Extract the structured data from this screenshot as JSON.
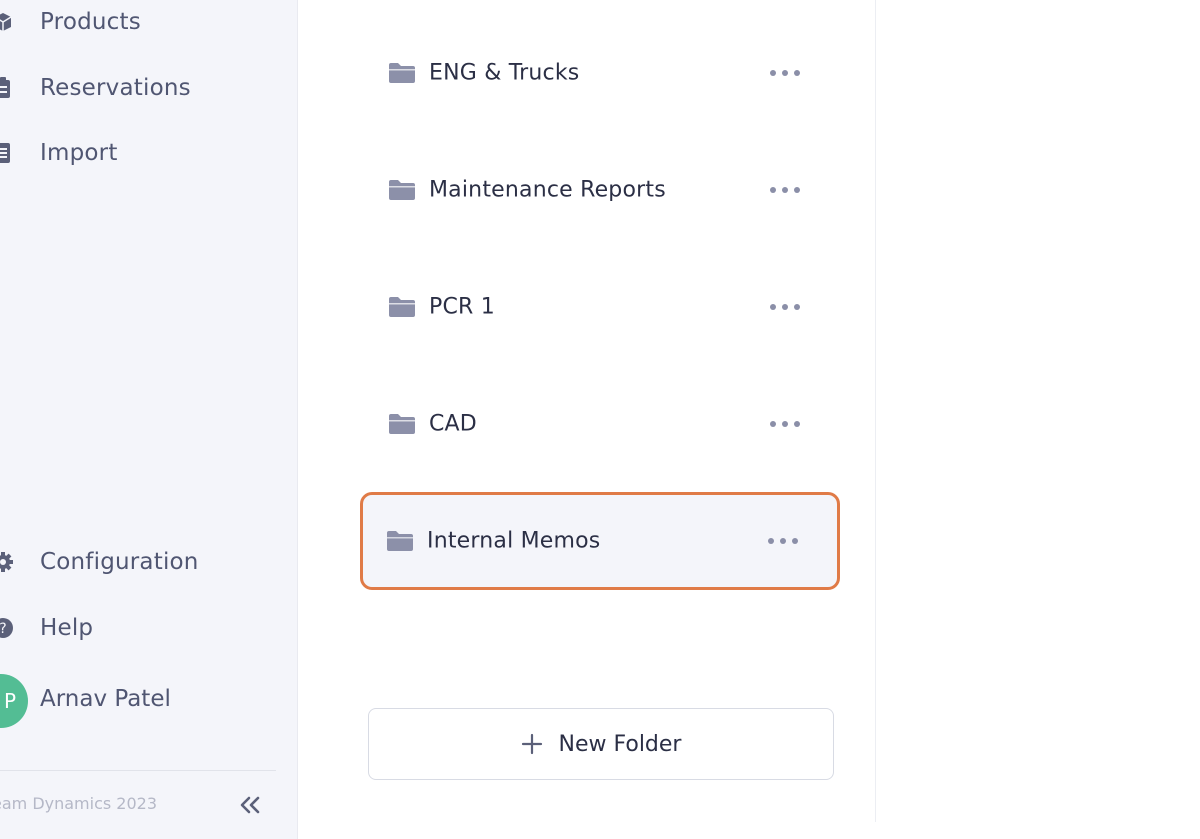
{
  "sidebar": {
    "nav_top": [
      {
        "label": "Products",
        "icon": "products-icon"
      },
      {
        "label": "Reservations",
        "icon": "reservations-icon"
      },
      {
        "label": "Import",
        "icon": "import-icon"
      }
    ],
    "nav_bottom": [
      {
        "label": "Configuration",
        "icon": "gear-icon"
      },
      {
        "label": "Help",
        "icon": "help-icon"
      }
    ],
    "user": {
      "initial": "P",
      "name": "Arnav Patel",
      "avatar_color": "#53bd94"
    },
    "footer": "eam Dynamics 2023",
    "collapse_icon": "double-chevron-left-icon"
  },
  "folders": {
    "items": [
      {
        "name": "ENG & Trucks"
      },
      {
        "name": "Maintenance Reports"
      },
      {
        "name": "PCR 1"
      },
      {
        "name": "CAD"
      },
      {
        "name": "Internal Memos",
        "selected": true
      }
    ],
    "new_folder_label": "New Folder",
    "selection_color": "#e07b47"
  }
}
